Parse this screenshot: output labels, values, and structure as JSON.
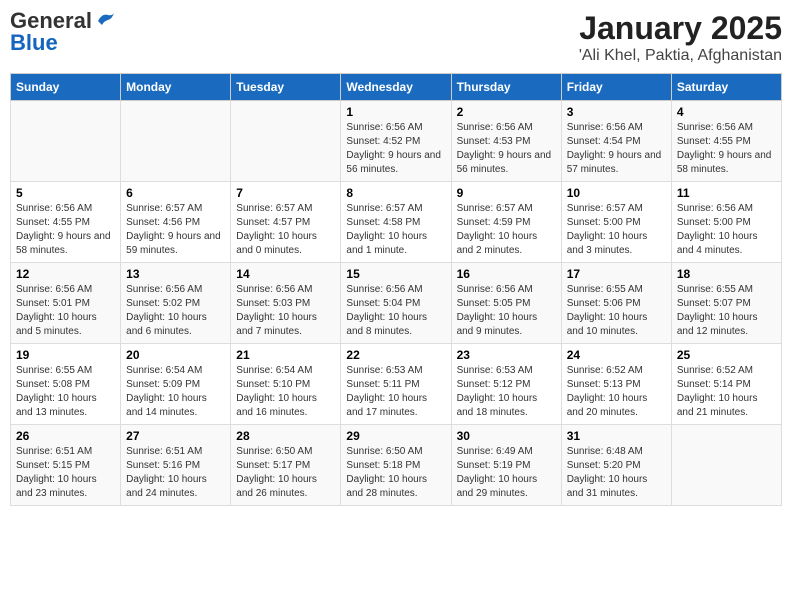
{
  "header": {
    "logo_general": "General",
    "logo_blue": "Blue",
    "title": "January 2025",
    "subtitle": "'Ali Khel, Paktia, Afghanistan"
  },
  "calendar": {
    "days_of_week": [
      "Sunday",
      "Monday",
      "Tuesday",
      "Wednesday",
      "Thursday",
      "Friday",
      "Saturday"
    ],
    "weeks": [
      [
        {
          "day": "",
          "info": ""
        },
        {
          "day": "",
          "info": ""
        },
        {
          "day": "",
          "info": ""
        },
        {
          "day": "1",
          "info": "Sunrise: 6:56 AM\nSunset: 4:52 PM\nDaylight: 9 hours and 56 minutes."
        },
        {
          "day": "2",
          "info": "Sunrise: 6:56 AM\nSunset: 4:53 PM\nDaylight: 9 hours and 56 minutes."
        },
        {
          "day": "3",
          "info": "Sunrise: 6:56 AM\nSunset: 4:54 PM\nDaylight: 9 hours and 57 minutes."
        },
        {
          "day": "4",
          "info": "Sunrise: 6:56 AM\nSunset: 4:55 PM\nDaylight: 9 hours and 58 minutes."
        }
      ],
      [
        {
          "day": "5",
          "info": "Sunrise: 6:56 AM\nSunset: 4:55 PM\nDaylight: 9 hours and 58 minutes."
        },
        {
          "day": "6",
          "info": "Sunrise: 6:57 AM\nSunset: 4:56 PM\nDaylight: 9 hours and 59 minutes."
        },
        {
          "day": "7",
          "info": "Sunrise: 6:57 AM\nSunset: 4:57 PM\nDaylight: 10 hours and 0 minutes."
        },
        {
          "day": "8",
          "info": "Sunrise: 6:57 AM\nSunset: 4:58 PM\nDaylight: 10 hours and 1 minute."
        },
        {
          "day": "9",
          "info": "Sunrise: 6:57 AM\nSunset: 4:59 PM\nDaylight: 10 hours and 2 minutes."
        },
        {
          "day": "10",
          "info": "Sunrise: 6:57 AM\nSunset: 5:00 PM\nDaylight: 10 hours and 3 minutes."
        },
        {
          "day": "11",
          "info": "Sunrise: 6:56 AM\nSunset: 5:00 PM\nDaylight: 10 hours and 4 minutes."
        }
      ],
      [
        {
          "day": "12",
          "info": "Sunrise: 6:56 AM\nSunset: 5:01 PM\nDaylight: 10 hours and 5 minutes."
        },
        {
          "day": "13",
          "info": "Sunrise: 6:56 AM\nSunset: 5:02 PM\nDaylight: 10 hours and 6 minutes."
        },
        {
          "day": "14",
          "info": "Sunrise: 6:56 AM\nSunset: 5:03 PM\nDaylight: 10 hours and 7 minutes."
        },
        {
          "day": "15",
          "info": "Sunrise: 6:56 AM\nSunset: 5:04 PM\nDaylight: 10 hours and 8 minutes."
        },
        {
          "day": "16",
          "info": "Sunrise: 6:56 AM\nSunset: 5:05 PM\nDaylight: 10 hours and 9 minutes."
        },
        {
          "day": "17",
          "info": "Sunrise: 6:55 AM\nSunset: 5:06 PM\nDaylight: 10 hours and 10 minutes."
        },
        {
          "day": "18",
          "info": "Sunrise: 6:55 AM\nSunset: 5:07 PM\nDaylight: 10 hours and 12 minutes."
        }
      ],
      [
        {
          "day": "19",
          "info": "Sunrise: 6:55 AM\nSunset: 5:08 PM\nDaylight: 10 hours and 13 minutes."
        },
        {
          "day": "20",
          "info": "Sunrise: 6:54 AM\nSunset: 5:09 PM\nDaylight: 10 hours and 14 minutes."
        },
        {
          "day": "21",
          "info": "Sunrise: 6:54 AM\nSunset: 5:10 PM\nDaylight: 10 hours and 16 minutes."
        },
        {
          "day": "22",
          "info": "Sunrise: 6:53 AM\nSunset: 5:11 PM\nDaylight: 10 hours and 17 minutes."
        },
        {
          "day": "23",
          "info": "Sunrise: 6:53 AM\nSunset: 5:12 PM\nDaylight: 10 hours and 18 minutes."
        },
        {
          "day": "24",
          "info": "Sunrise: 6:52 AM\nSunset: 5:13 PM\nDaylight: 10 hours and 20 minutes."
        },
        {
          "day": "25",
          "info": "Sunrise: 6:52 AM\nSunset: 5:14 PM\nDaylight: 10 hours and 21 minutes."
        }
      ],
      [
        {
          "day": "26",
          "info": "Sunrise: 6:51 AM\nSunset: 5:15 PM\nDaylight: 10 hours and 23 minutes."
        },
        {
          "day": "27",
          "info": "Sunrise: 6:51 AM\nSunset: 5:16 PM\nDaylight: 10 hours and 24 minutes."
        },
        {
          "day": "28",
          "info": "Sunrise: 6:50 AM\nSunset: 5:17 PM\nDaylight: 10 hours and 26 minutes."
        },
        {
          "day": "29",
          "info": "Sunrise: 6:50 AM\nSunset: 5:18 PM\nDaylight: 10 hours and 28 minutes."
        },
        {
          "day": "30",
          "info": "Sunrise: 6:49 AM\nSunset: 5:19 PM\nDaylight: 10 hours and 29 minutes."
        },
        {
          "day": "31",
          "info": "Sunrise: 6:48 AM\nSunset: 5:20 PM\nDaylight: 10 hours and 31 minutes."
        },
        {
          "day": "",
          "info": ""
        }
      ]
    ]
  }
}
